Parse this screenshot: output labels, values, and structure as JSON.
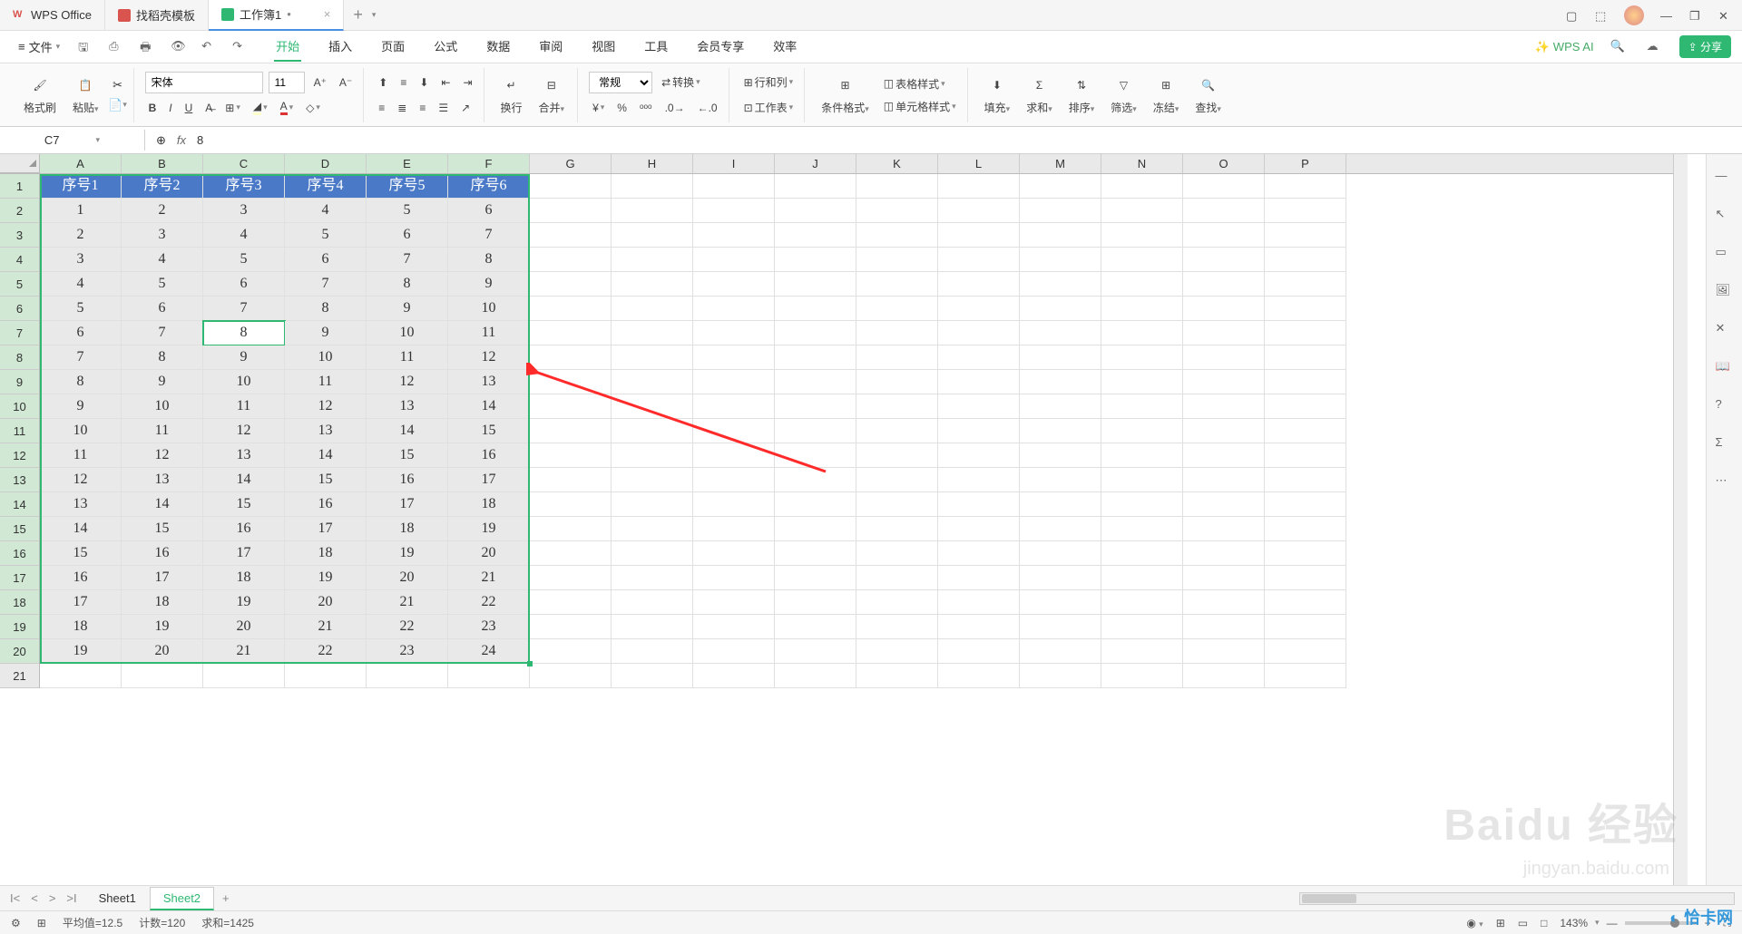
{
  "title_tabs": [
    {
      "label": "WPS Office",
      "icon": "wps"
    },
    {
      "label": "找稻壳模板",
      "icon": "doc"
    },
    {
      "label": "工作簿1",
      "icon": "sheet",
      "active": true,
      "dirty": "•"
    }
  ],
  "file_label": "文件",
  "menu_tabs": [
    "开始",
    "插入",
    "页面",
    "公式",
    "数据",
    "审阅",
    "视图",
    "工具",
    "会员专享",
    "效率"
  ],
  "menu_active": "开始",
  "wps_ai": "WPS AI",
  "share": "分享",
  "ribbon": {
    "format_painter": "格式刷",
    "paste": "粘贴",
    "font": "宋体",
    "size": "11",
    "wrap": "换行",
    "merge": "合并",
    "number_format": "常规",
    "convert": "转换",
    "row_col": "行和列",
    "worksheet": "工作表",
    "cond_fmt": "条件格式",
    "table_style": "表格样式",
    "cell_style": "单元格样式",
    "fill": "填充",
    "sum": "求和",
    "sort": "排序",
    "filter": "筛选",
    "freeze": "冻结",
    "find": "查找"
  },
  "name_box": "C7",
  "formula": "8",
  "grid": {
    "cols": [
      "A",
      "B",
      "C",
      "D",
      "E",
      "F",
      "G",
      "H",
      "I",
      "J",
      "K",
      "L",
      "M",
      "N",
      "O",
      "P"
    ],
    "row_count": 20,
    "headers": [
      "序号1",
      "序号2",
      "序号3",
      "序号4",
      "序号5",
      "序号6"
    ],
    "data": [
      [
        1,
        2,
        3,
        4,
        5,
        6
      ],
      [
        2,
        3,
        4,
        5,
        6,
        7
      ],
      [
        3,
        4,
        5,
        6,
        7,
        8
      ],
      [
        4,
        5,
        6,
        7,
        8,
        9
      ],
      [
        5,
        6,
        7,
        8,
        9,
        10
      ],
      [
        6,
        7,
        8,
        9,
        10,
        11
      ],
      [
        7,
        8,
        9,
        10,
        11,
        12
      ],
      [
        8,
        9,
        10,
        11,
        12,
        13
      ],
      [
        9,
        10,
        11,
        12,
        13,
        14
      ],
      [
        10,
        11,
        12,
        13,
        14,
        15
      ],
      [
        11,
        12,
        13,
        14,
        15,
        16
      ],
      [
        12,
        13,
        14,
        15,
        16,
        17
      ],
      [
        13,
        14,
        15,
        16,
        17,
        18
      ],
      [
        14,
        15,
        16,
        17,
        18,
        19
      ],
      [
        15,
        16,
        17,
        18,
        19,
        20
      ],
      [
        16,
        17,
        18,
        19,
        20,
        21
      ],
      [
        17,
        18,
        19,
        20,
        21,
        22
      ],
      [
        18,
        19,
        20,
        21,
        22,
        23
      ],
      [
        19,
        20,
        21,
        22,
        23,
        24
      ]
    ],
    "active": {
      "row": 7,
      "col": 3
    },
    "sel_cols": 6,
    "sel_rows": 20
  },
  "sheets": [
    "Sheet1",
    "Sheet2"
  ],
  "active_sheet": "Sheet2",
  "status": {
    "avg_label": "平均值=",
    "avg": "12.5",
    "count_label": "计数=",
    "count": "120",
    "sum_label": "求和=",
    "sum": "1425",
    "zoom": "143%"
  },
  "watermark": {
    "main": "Baidu 经验",
    "sub": "jingyan.baidu.com",
    "logo": "恰卡网"
  }
}
